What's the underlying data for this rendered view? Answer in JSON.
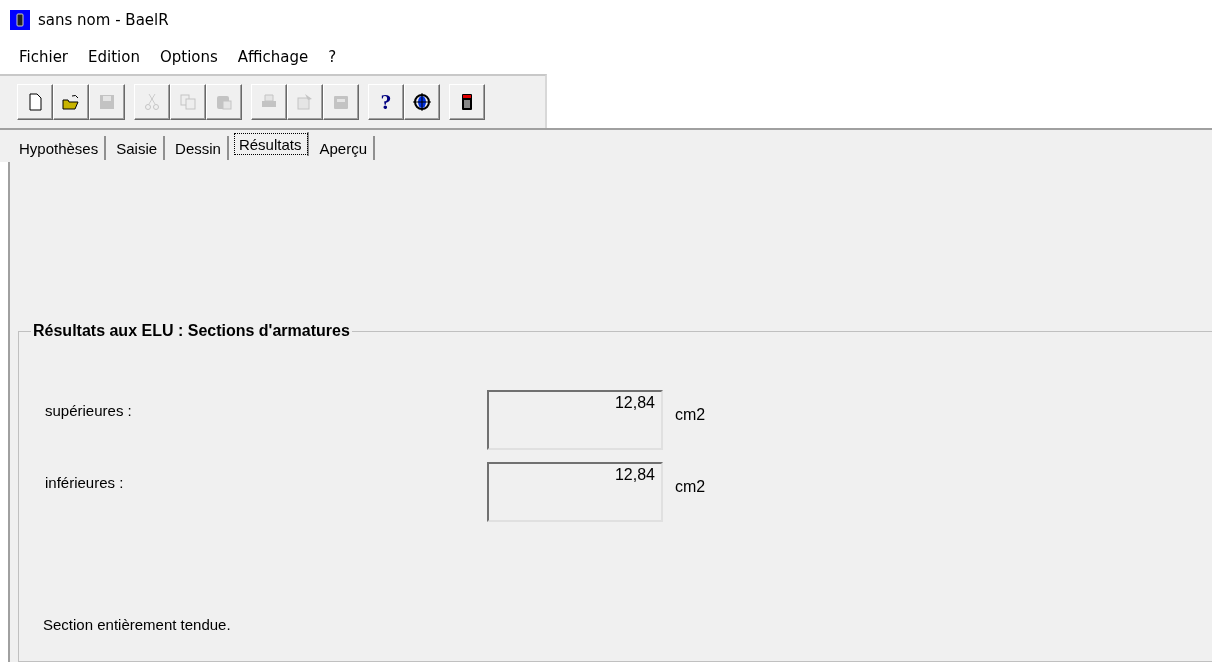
{
  "window": {
    "title": "sans nom - BaelR"
  },
  "menu": [
    "Fichier",
    "Edition",
    "Options",
    "Affichage",
    "?"
  ],
  "toolbar": [
    [
      {
        "kind": "new",
        "disabled": false
      },
      {
        "kind": "open",
        "disabled": false
      },
      {
        "kind": "save",
        "disabled": true
      }
    ],
    [
      {
        "kind": "cut",
        "disabled": true
      },
      {
        "kind": "copy",
        "disabled": true
      },
      {
        "kind": "paste",
        "disabled": true
      }
    ],
    [
      {
        "kind": "print",
        "disabled": true
      },
      {
        "kind": "preview",
        "disabled": true
      },
      {
        "kind": "printer",
        "disabled": true
      }
    ],
    [
      {
        "kind": "help",
        "disabled": false,
        "label": "?"
      },
      {
        "kind": "globe",
        "disabled": false
      }
    ],
    [
      {
        "kind": "calculator",
        "disabled": false
      }
    ]
  ],
  "tabs": [
    {
      "label": "Hypothèses",
      "selected": false
    },
    {
      "label": "Saisie",
      "selected": false
    },
    {
      "label": "Dessin",
      "selected": false
    },
    {
      "label": "Résultats",
      "selected": true
    },
    {
      "label": "Aperçu",
      "selected": false
    }
  ],
  "group": {
    "title": "Résultats aux ELU : Sections d'armatures",
    "rows": [
      {
        "label": "supérieures :",
        "value": "12,84",
        "unit": "cm2"
      },
      {
        "label": "inférieures :",
        "value": "12,84",
        "unit": "cm2"
      }
    ],
    "note": "Section entièrement tendue."
  }
}
